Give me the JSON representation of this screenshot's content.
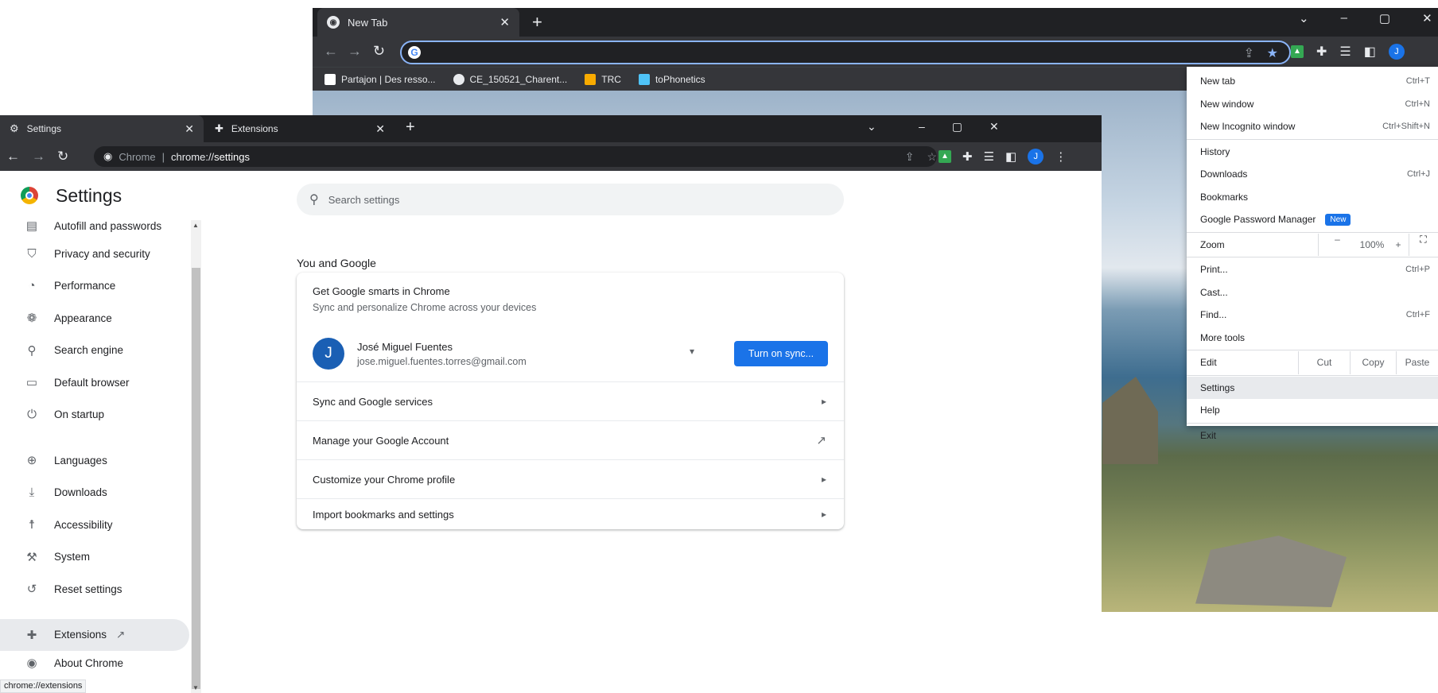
{
  "background_window": {
    "tab_title": "New Tab",
    "new_tab_glyph": "+",
    "window_controls": [
      "⌄",
      "–",
      "▢",
      "✕"
    ],
    "bookmarks": [
      {
        "label": "Partajon | Des resso...",
        "icon_color": "#ffffff"
      },
      {
        "label": "CE_150521_Charent...",
        "icon_color": "#e8eaed"
      },
      {
        "label": "TRC",
        "icon_color": "#f9ab00"
      },
      {
        "label": "toPhonetics",
        "icon_color": "#4fc3f7"
      }
    ]
  },
  "chrome_menu": {
    "items": [
      {
        "label": "New tab",
        "shortcut": "Ctrl+T"
      },
      {
        "label": "New window",
        "shortcut": "Ctrl+N"
      },
      {
        "label": "New Incognito window",
        "shortcut": "Ctrl+Shift+N"
      }
    ],
    "items2": [
      {
        "label": "History",
        "shortcut": ""
      },
      {
        "label": "Downloads",
        "shortcut": "Ctrl+J"
      },
      {
        "label": "Bookmarks",
        "shortcut": ""
      },
      {
        "label": "Google Password Manager",
        "shortcut": "",
        "badge": "New"
      }
    ],
    "zoom": {
      "label": "Zoom",
      "minus": "–",
      "value": "100%",
      "plus": "+",
      "fullscreen": "⛶"
    },
    "items3": [
      {
        "label": "Print...",
        "shortcut": "Ctrl+P"
      },
      {
        "label": "Cast...",
        "shortcut": ""
      },
      {
        "label": "Find...",
        "shortcut": "Ctrl+F"
      },
      {
        "label": "More tools",
        "shortcut": ""
      }
    ],
    "edit": {
      "label": "Edit",
      "cut": "Cut",
      "copy": "Copy",
      "paste": "Paste"
    },
    "items4": [
      {
        "label": "Settings",
        "shortcut": ""
      },
      {
        "label": "Help",
        "shortcut": ""
      },
      {
        "label": "Exit",
        "shortcut": ""
      }
    ]
  },
  "foreground_window": {
    "tabs": [
      {
        "label": "Settings"
      },
      {
        "label": "Extensions"
      }
    ],
    "omnibox": {
      "site_label": "Chrome",
      "separator": "|",
      "url_prefix": "chrome://",
      "url_bold": "settings"
    },
    "avatar_initial": "J"
  },
  "settings": {
    "title": "Settings",
    "search_placeholder": "Search settings",
    "sidebar": [
      {
        "label": "Autofill and passwords",
        "icon": "autofill-icon"
      },
      {
        "label": "Privacy and security",
        "icon": "shield-icon"
      },
      {
        "label": "Performance",
        "icon": "speedometer-icon"
      },
      {
        "label": "Appearance",
        "icon": "palette-icon"
      },
      {
        "label": "Search engine",
        "icon": "search-icon"
      },
      {
        "label": "Default browser",
        "icon": "browser-icon"
      },
      {
        "label": "On startup",
        "icon": "power-icon"
      },
      {
        "label": "Languages",
        "icon": "globe-icon"
      },
      {
        "label": "Downloads",
        "icon": "download-icon"
      },
      {
        "label": "Accessibility",
        "icon": "accessibility-icon"
      },
      {
        "label": "System",
        "icon": "wrench-icon"
      },
      {
        "label": "Reset settings",
        "icon": "reset-icon"
      },
      {
        "label": "Extensions",
        "icon": "puzzle-icon"
      },
      {
        "label": "About Chrome",
        "icon": "chrome-icon"
      }
    ],
    "section_title": "You and Google",
    "card": {
      "heading": "Get Google smarts in Chrome",
      "subheading": "Sync and personalize Chrome across your devices",
      "account_name": "José Miguel Fuentes",
      "account_email": "jose.miguel.fuentes.torres@gmail.com",
      "avatar_initial": "J",
      "sync_button": "Turn on sync...",
      "rows": [
        {
          "label": "Sync and Google services",
          "icon": "chevron-right-icon"
        },
        {
          "label": "Manage your Google Account",
          "icon": "open-external-icon"
        },
        {
          "label": "Customize your Chrome profile",
          "icon": "chevron-right-icon"
        },
        {
          "label": "Import bookmarks and settings",
          "icon": "chevron-right-icon"
        }
      ]
    },
    "status_url": "chrome://extensions"
  },
  "colors": {
    "accent": "#1a73e8",
    "dark_chrome": "#202124",
    "toolbar": "#35363a"
  }
}
